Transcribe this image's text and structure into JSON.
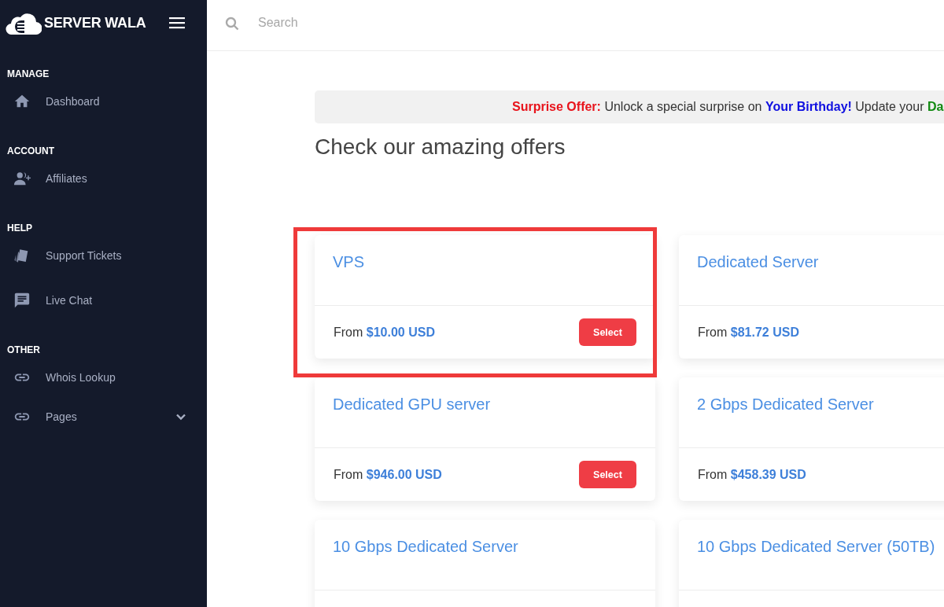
{
  "sidebar": {
    "brand": "SERVER WALA",
    "sections": [
      {
        "title": "MANAGE",
        "items": [
          {
            "label": "Dashboard",
            "has_submenu": false
          }
        ]
      },
      {
        "title": "ACCOUNT",
        "items": [
          {
            "label": "Affiliates",
            "has_submenu": false
          }
        ]
      },
      {
        "title": "HELP",
        "items": [
          {
            "label": "Support Tickets",
            "has_submenu": false
          },
          {
            "label": "Live Chat",
            "has_submenu": false
          }
        ]
      },
      {
        "title": "OTHER",
        "items": [
          {
            "label": "Whois Lookup",
            "has_submenu": false
          },
          {
            "label": "Pages",
            "has_submenu": true
          }
        ]
      }
    ]
  },
  "topbar": {
    "search": {
      "placeholder": "Search"
    }
  },
  "banner": {
    "segments": [
      {
        "text": "Surprise Offer:",
        "color": "#e8141c"
      },
      {
        "text": "Unlock a special surprise on",
        "color": "#333333"
      },
      {
        "text": "Your Birthday!",
        "color": "#1010e0"
      },
      {
        "text": "Update your",
        "color": "#333333"
      },
      {
        "text": "Da",
        "color": "#128a12"
      }
    ]
  },
  "heading": "Check our amazing offers",
  "products": [
    {
      "title": "VPS",
      "price": "From **$10.00 USD**",
      "button": "Select",
      "highlighted": true
    },
    {
      "title": "Dedicated Server",
      "price": "From **$81.72 USD**",
      "highlighted": false
    },
    {
      "title": "Dedicated GPU server",
      "price": "From **$946.00 USD**",
      "button": "Select",
      "highlighted": false
    },
    {
      "title": "2 Gbps Dedicated Server",
      "price": "From **$458.39 USD**",
      "highlighted": false
    },
    {
      "title": "10 Gbps Dedicated Server",
      "highlighted": false
    },
    {
      "title": "10 Gbps Dedicated Server (50TB)",
      "highlighted": false
    }
  ]
}
